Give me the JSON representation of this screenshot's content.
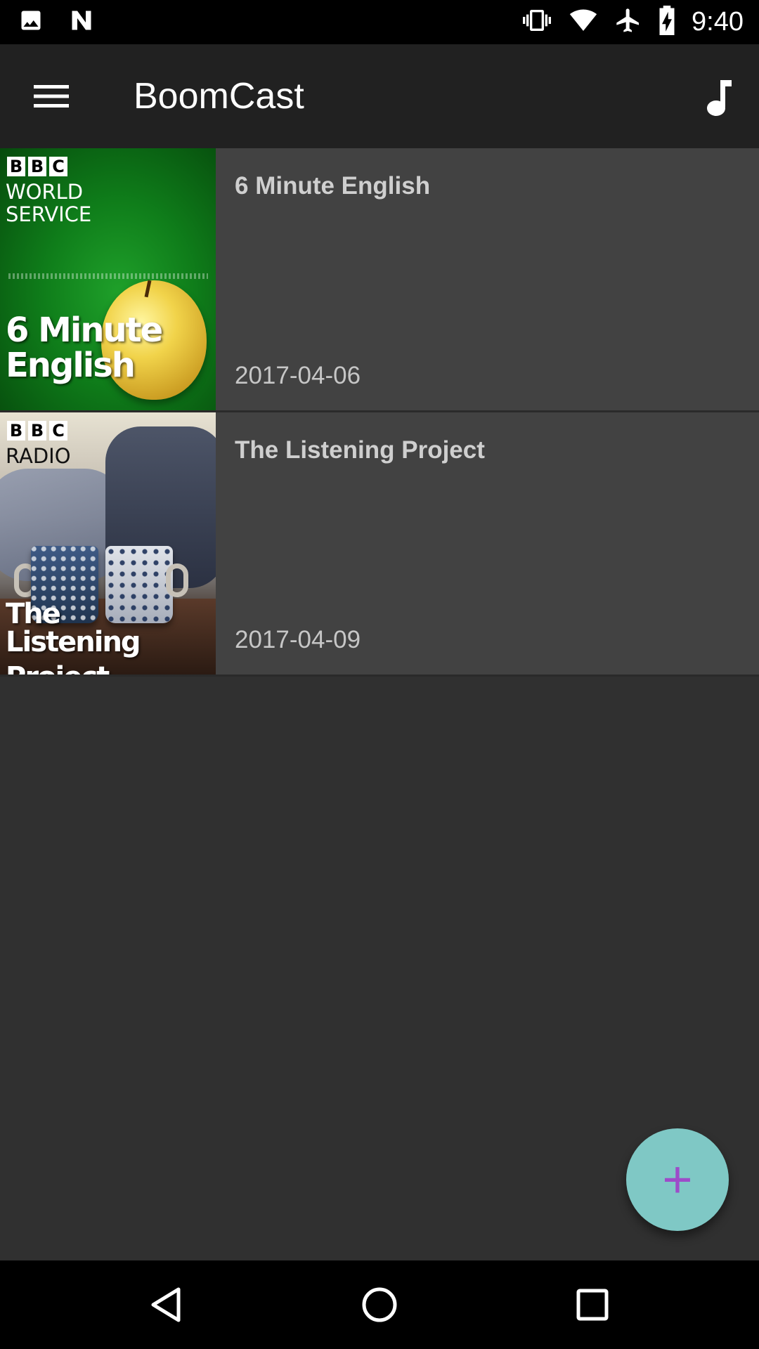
{
  "status_bar": {
    "time": "9:40",
    "icons": [
      "image-icon",
      "n-icon",
      "vibrate-icon",
      "wifi-icon",
      "airplane-icon",
      "battery-charging-icon"
    ]
  },
  "app_bar": {
    "title": "BoomCast",
    "menu_icon": "hamburger-menu-icon",
    "action_icon": "music-note-icon"
  },
  "podcasts": [
    {
      "title": "6 Minute English",
      "date": "2017-04-06",
      "cover": {
        "logo": [
          "B",
          "B",
          "C"
        ],
        "subtitle_lines": [
          "WORLD",
          "SERVICE"
        ],
        "title_lines": [
          "6 Minute",
          "English"
        ]
      }
    },
    {
      "title": "The Listening Project",
      "date": "2017-04-09",
      "cover": {
        "logo": [
          "B",
          "B",
          "C"
        ],
        "subtitle_lines": [
          "RADIO"
        ],
        "title_lines": [
          "The",
          "Listening Project"
        ]
      }
    }
  ],
  "fab": {
    "label": "+",
    "color": "#7fc8c5",
    "icon_color": "#9d4cc9"
  },
  "nav_bar": {
    "buttons": [
      "back-icon",
      "home-icon",
      "recents-icon"
    ]
  },
  "colors": {
    "background": "#303030",
    "app_bar": "#212121",
    "row": "#424242"
  }
}
